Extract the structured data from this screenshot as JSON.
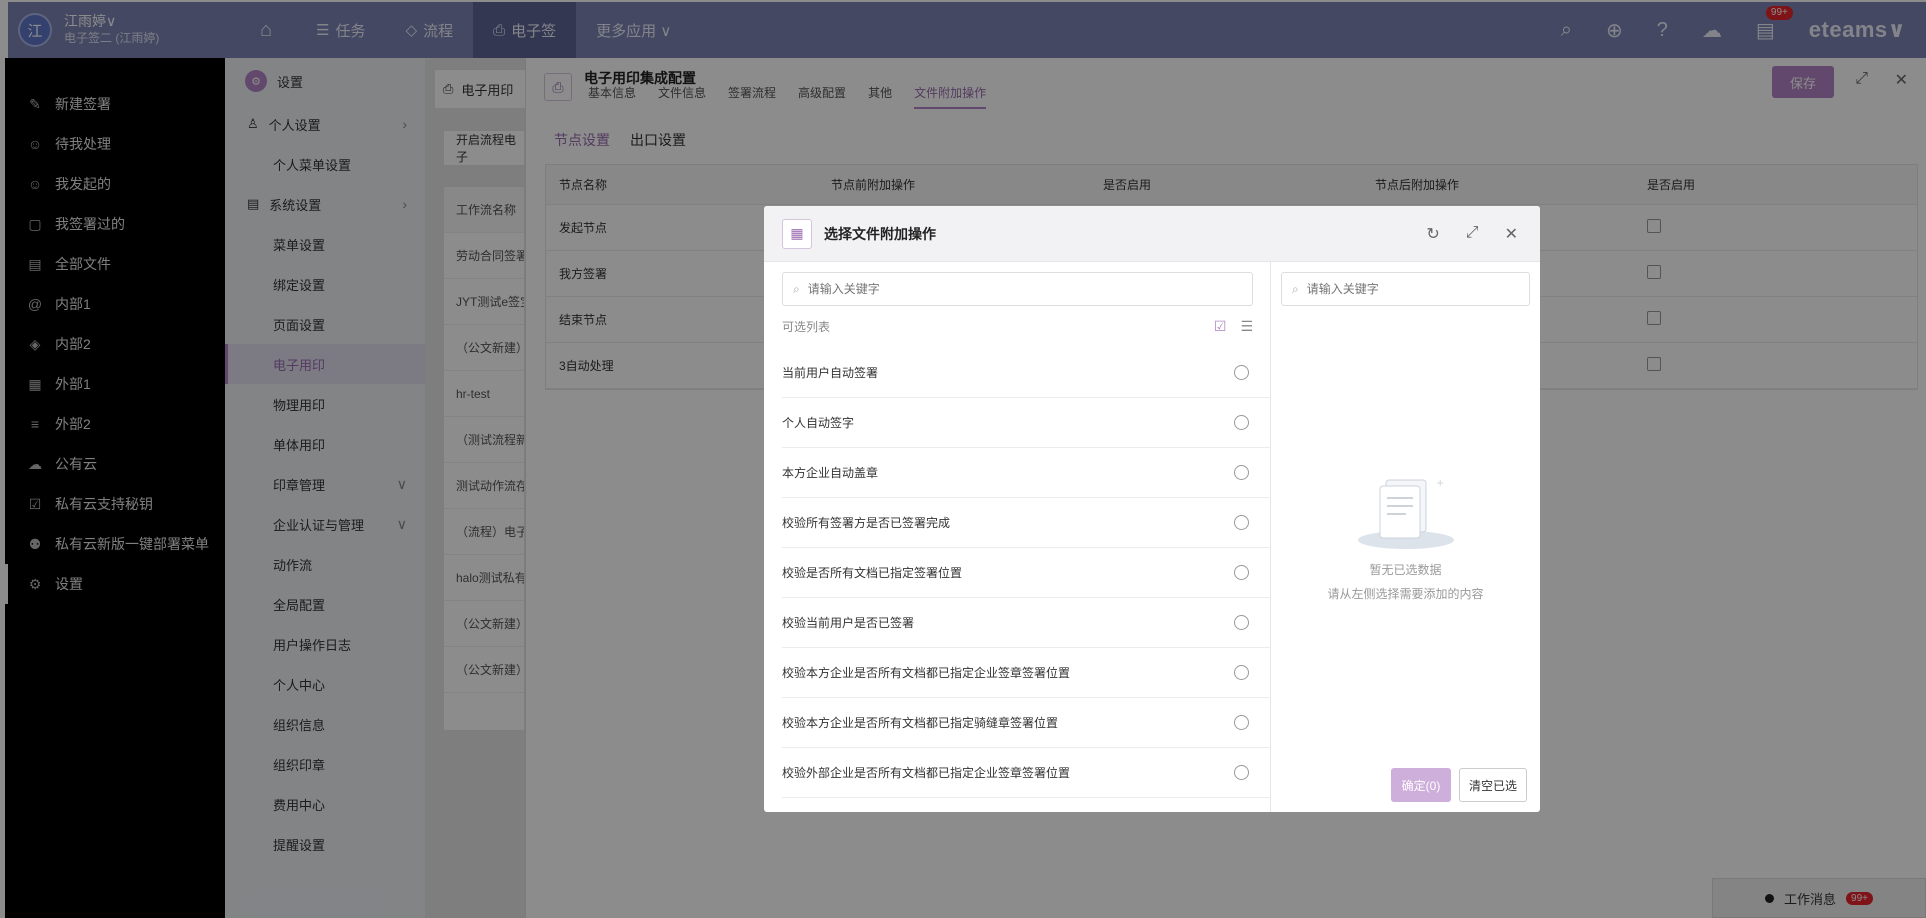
{
  "user": {
    "avatar_text": "江",
    "name": "江雨婷∨",
    "subtitle": "电子签二 (江雨婷)"
  },
  "topnav": {
    "items": [
      {
        "label": "任务",
        "icon": "☰"
      },
      {
        "label": "流程",
        "icon": "◇"
      },
      {
        "label": "电子签",
        "icon": "⎙"
      },
      {
        "label": "更多应用 ∨",
        "icon": ""
      }
    ],
    "badge": "99+",
    "logo": "eteams∨"
  },
  "leftnav": {
    "items": [
      {
        "label": "新建签署",
        "icon": "✎"
      },
      {
        "label": "待我处理",
        "icon": "☺"
      },
      {
        "label": "我发起的",
        "icon": "☺"
      },
      {
        "label": "我签署过的",
        "icon": "▢"
      },
      {
        "label": "全部文件",
        "icon": "▤"
      },
      {
        "label": "内部1",
        "icon": "@"
      },
      {
        "label": "内部2",
        "icon": "◈"
      },
      {
        "label": "外部1",
        "icon": "▦"
      },
      {
        "label": "外部2",
        "icon": "≡"
      },
      {
        "label": "公有云",
        "icon": "☁"
      },
      {
        "label": "私有云支持秘钥",
        "icon": "☑"
      },
      {
        "label": "私有云新版一键部署菜单",
        "icon": "⚉"
      },
      {
        "label": "设置",
        "icon": "⚙"
      }
    ]
  },
  "settings": {
    "title": "设置",
    "items": [
      {
        "label": "个人设置",
        "type": "grp"
      },
      {
        "label": "个人菜单设置",
        "type": "item"
      },
      {
        "label": "系统设置",
        "type": "grp"
      },
      {
        "label": "菜单设置",
        "type": "item"
      },
      {
        "label": "绑定设置",
        "type": "item"
      },
      {
        "label": "页面设置",
        "type": "item"
      },
      {
        "label": "电子用印",
        "type": "sel"
      },
      {
        "label": "物理用印",
        "type": "item"
      },
      {
        "label": "单体用印",
        "type": "item"
      },
      {
        "label": "印章管理",
        "type": "exp"
      },
      {
        "label": "企业认证与管理",
        "type": "exp"
      },
      {
        "label": "动作流",
        "type": "item"
      },
      {
        "label": "全局配置",
        "type": "item"
      },
      {
        "label": "用户操作日志",
        "type": "item"
      },
      {
        "label": "个人中心",
        "type": "item"
      },
      {
        "label": "组织信息",
        "type": "item"
      },
      {
        "label": "组织印章",
        "type": "item"
      },
      {
        "label": "费用中心",
        "type": "item"
      },
      {
        "label": "提醒设置",
        "type": "item"
      }
    ]
  },
  "midpanel": {
    "head": "电子用印",
    "button": "开启流程电子",
    "column": "工作流名称",
    "rows": [
      "劳动合同签署",
      "JYT测试e签宝",
      "（公文新建）",
      "hr-test",
      "（测试流程新",
      "测试动作流存",
      "（流程）电子",
      "halo测试私有",
      "（公文新建）",
      "（公文新建）"
    ]
  },
  "drawer": {
    "title": "电子用印集成配置",
    "tabs": [
      "基本信息",
      "文件信息",
      "签署流程",
      "高级配置",
      "其他",
      "文件附加操作"
    ],
    "active_tab": 5,
    "save": "保存",
    "subtabs": [
      "节点设置",
      "出口设置"
    ],
    "table": {
      "headers": [
        "节点名称",
        "节点前附加操作",
        "是否启用",
        "节点后附加操作",
        "是否启用"
      ],
      "rows": [
        "发起节点",
        "我方签署",
        "结束节点",
        "3自动处理"
      ]
    },
    "chat_label": "工作消息",
    "chat_badge": "99+"
  },
  "modal": {
    "title": "选择文件附加操作",
    "search_placeholder": "请输入关键字",
    "right_search_placeholder": "请输入关键字",
    "list_title": "可选列表",
    "options": [
      "当前用户自动签署",
      "个人自动签字",
      "本方企业自动盖章",
      "校验所有签署方是否已签署完成",
      "校验是否所有文档已指定签署位置",
      "校验当前用户是否已签署",
      "校验本方企业是否所有文档都已指定企业签章签署位置",
      "校验本方企业是否所有文档都已指定骑缝章签署位置",
      "校验外部企业是否所有文档都已指定企业签章签署位置"
    ],
    "empty_title": "暂无已选数据",
    "empty_hint": "请从左侧选择需要添加的内容",
    "confirm": "确定(0)",
    "clear": "清空已选"
  }
}
